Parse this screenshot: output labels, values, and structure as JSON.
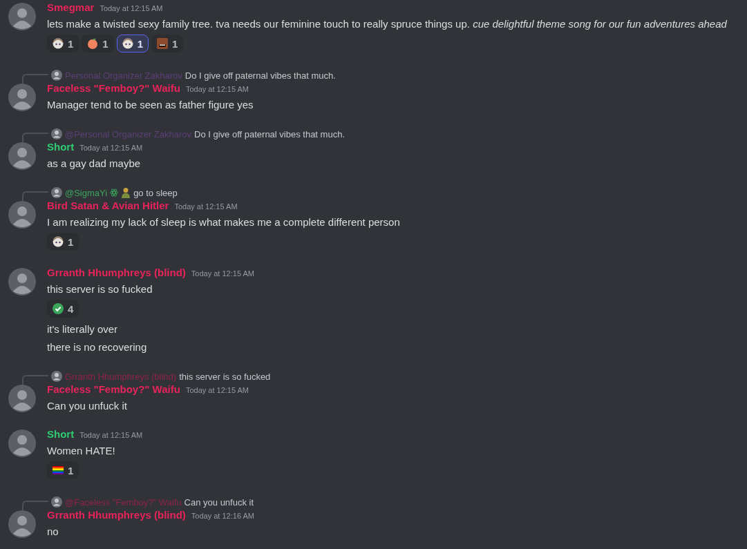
{
  "messages": [
    {
      "author": "Smegmar",
      "color": "#e8235a",
      "timestamp": "Today at 12:15 AM",
      "lines": [
        {
          "text": "lets make a twisted sexy family tree. tva needs our feminine touch to really spruce things up. *cue delightful theme song for our fun adventures ahead*",
          "reactions": [
            {
              "kind": "sticker",
              "count": "1",
              "selected": false
            },
            {
              "kind": "peach",
              "count": "1",
              "selected": false
            },
            {
              "kind": "sticker",
              "count": "1",
              "selected": true
            },
            {
              "kind": "face",
              "count": "1",
              "selected": false
            }
          ]
        }
      ]
    },
    {
      "reply": {
        "name": "Personal Organizer Zakharov",
        "color": "#5b3f78",
        "text": "Do I give off paternal vibes that much."
      },
      "author": "Faceless \"Femboy?\" Waifu",
      "color": "#e8235a",
      "timestamp": "Today at 12:15 AM",
      "lines": [
        {
          "text": "Manager tend to be seen as father figure yes"
        }
      ]
    },
    {
      "reply": {
        "name": "@Personal Organizer Zakharov",
        "color": "#5b3f78",
        "text": "Do I give off paternal vibes that much."
      },
      "author": "Short",
      "color": "#2ecc71",
      "timestamp": "Today at 12:15 AM",
      "lines": [
        {
          "text": "as a gay dad maybe"
        }
      ]
    },
    {
      "reply": {
        "name": "@SigmaYi",
        "color": "#3ba55c",
        "emojis": [
          {
            "kind": "atom"
          },
          {
            "kind": "person"
          }
        ],
        "text": "go to sleep"
      },
      "author": "Bird Satan & Avian Hitler",
      "color": "#e8235a",
      "timestamp": "Today at 12:15 AM",
      "lines": [
        {
          "text": "I am realizing my lack of sleep is what makes me a complete different person",
          "reactions": [
            {
              "kind": "sticker",
              "count": "1",
              "selected": false
            }
          ]
        }
      ]
    },
    {
      "author": "Grranth Hhumphreys (blind)",
      "color": "#e8235a",
      "timestamp": "Today at 12:15 AM",
      "lines": [
        {
          "text": "this server is so fucked",
          "reactions": [
            {
              "kind": "check",
              "count": "4",
              "selected": false
            }
          ]
        },
        {
          "text": "it's literally over"
        },
        {
          "text": "there is no recovering"
        }
      ]
    },
    {
      "reply": {
        "name": "Grranth Hhumphreys (blind)",
        "color": "#8f2347",
        "text": "this server is so fucked"
      },
      "author": "Faceless \"Femboy?\" Waifu",
      "color": "#e8235a",
      "timestamp": "Today at 12:15 AM",
      "lines": [
        {
          "text": "Can you unfuck it"
        }
      ]
    },
    {
      "author": "Short",
      "color": "#2ecc71",
      "timestamp": "Today at 12:15 AM",
      "lines": [
        {
          "text": "Women HATE!",
          "reactions": [
            {
              "kind": "flag",
              "count": "1",
              "selected": false
            }
          ]
        }
      ]
    },
    {
      "reply": {
        "name": "@Faceless \"Femboy?\" Waifu",
        "color": "#8f2347",
        "text": "Can you unfuck it"
      },
      "author": "Grranth Hhumphreys (blind)",
      "color": "#e8235a",
      "timestamp": "Today at 12:16 AM",
      "lines": [
        {
          "text": "no"
        }
      ]
    }
  ]
}
